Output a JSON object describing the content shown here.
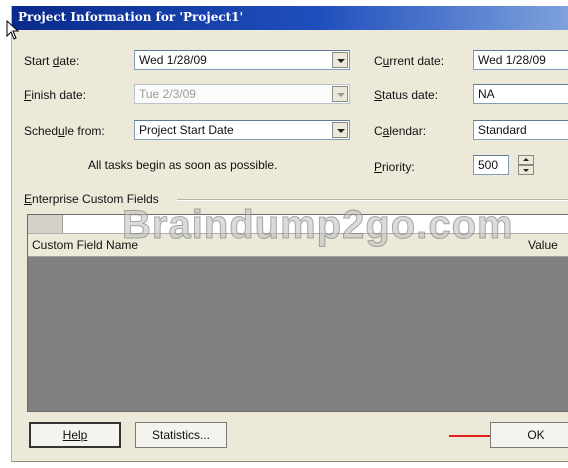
{
  "window": {
    "title": "Project Information for 'Project1'"
  },
  "fields": {
    "start_date": {
      "label": "Start date:",
      "value": "Wed 1/28/09"
    },
    "finish_date": {
      "label": "Finish date:",
      "value": "Tue 2/3/09"
    },
    "schedule_from": {
      "label": "Schedule from:",
      "value": "Project Start Date"
    },
    "schedule_note": "All tasks begin as soon as possible.",
    "current_date": {
      "label": "Current date:",
      "value": "Wed 1/28/09"
    },
    "status_date": {
      "label": "Status date:",
      "value": "NA"
    },
    "calendar": {
      "label": "Calendar:",
      "value": "Standard"
    },
    "priority": {
      "label": "Priority:",
      "value": "500"
    }
  },
  "enterprise": {
    "group_label": "Enterprise Custom Fields",
    "columns": [
      "Custom Field Name",
      "Value"
    ]
  },
  "watermark": "Braindump2go.com",
  "buttons": {
    "help": "Help",
    "statistics": "Statistics...",
    "ok": "OK"
  },
  "colors": {
    "annotation_arrow": "#e0201a",
    "titlebar_start": "#0a2a8c",
    "titlebar_end": "#7fa2dc"
  }
}
